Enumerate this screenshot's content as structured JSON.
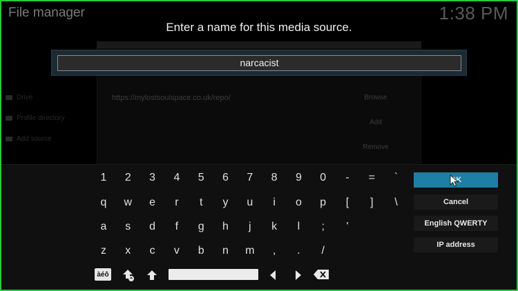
{
  "app": {
    "title": "File manager",
    "clock": "1:38 PM"
  },
  "background": {
    "url_text": "https://mylostsoulspace.co.uk/repo/",
    "buttons": [
      "Browse",
      "Add",
      "Remove"
    ],
    "sidebar": [
      "Drive",
      "Profile directory",
      "Add source"
    ]
  },
  "dialog": {
    "heading": "Enter a name for this media source.",
    "input_value": "narcacist"
  },
  "keyboard": {
    "row1": [
      "1",
      "2",
      "3",
      "4",
      "5",
      "6",
      "7",
      "8",
      "9",
      "0",
      "-",
      "=",
      "`"
    ],
    "row2": [
      "q",
      "w",
      "e",
      "r",
      "t",
      "y",
      "u",
      "i",
      "o",
      "p",
      "[",
      "]",
      "\\"
    ],
    "row3": [
      "a",
      "s",
      "d",
      "f",
      "g",
      "h",
      "j",
      "k",
      "l",
      ";",
      "'"
    ],
    "row4": [
      "z",
      "x",
      "c",
      "v",
      "b",
      "n",
      "m",
      ",",
      ".",
      "/"
    ],
    "symbols_label": "àéô"
  },
  "side_buttons": {
    "ok": "OK",
    "cancel": "Cancel",
    "layout": "English QWERTY",
    "ip": "IP address"
  },
  "colors": {
    "accent": "#1d7fa6",
    "frame": "#27c93f"
  }
}
